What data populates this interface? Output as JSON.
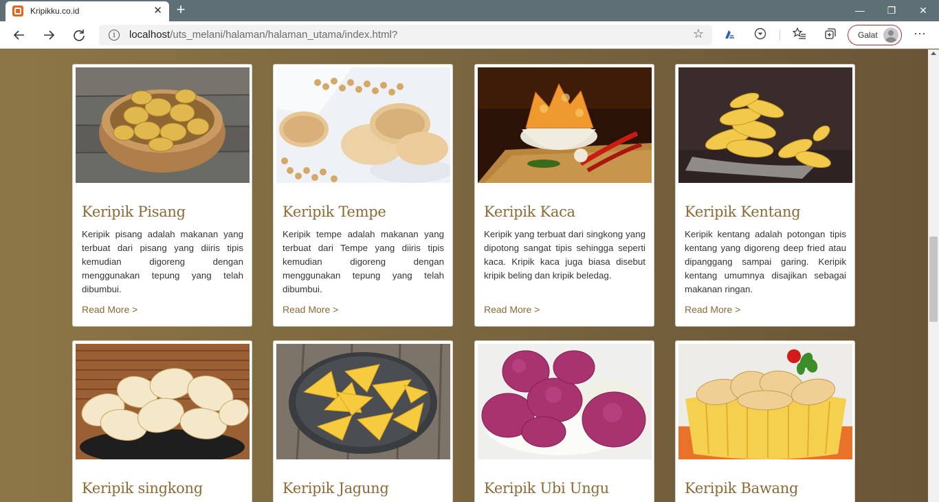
{
  "browser": {
    "tab_title": "Kripikku.co.id",
    "tab_close": "✕",
    "new_tab": "+",
    "url_host": "localhost",
    "url_path": "/uts_melani/halaman/halaman_utama/index.html?",
    "profile_label": "Galat",
    "window_controls": {
      "minimize": "—",
      "restore": "❐",
      "close": "✕"
    },
    "icons": [
      "back-arrow-icon",
      "forward-arrow-icon",
      "refresh-icon",
      "info-icon",
      "favorite-star-icon",
      "read-aloud-icon",
      "download-icon",
      "favorites-list-icon",
      "collections-icon",
      "profile-avatar-icon",
      "more-menu-icon"
    ]
  },
  "products": [
    {
      "title": "Keripik Pisang",
      "description": "Keripik pisang adalah makanan yang terbuat dari pisang yang diiris tipis kemudian digoreng dengan menggunakan tepung yang telah dibumbui.",
      "link": "Read More >"
    },
    {
      "title": "Keripik Tempe",
      "description": "Keripik tempe adalah makanan yang terbuat dari Tempe yang diiris tipis kemudian digoreng dengan menggunakan tepung yang telah dibumbui.",
      "link": "Read More >"
    },
    {
      "title": "Keripik Kaca",
      "description": "Keripik yang terbuat dari singkong yang dipotong sangat tipis sehingga seperti kaca. Kripik kaca juga biasa disebut kripik beling dan kripik beledag.",
      "link": "Read More >"
    },
    {
      "title": "Keripik Kentang",
      "description": "Keripik kentang adalah potongan tipis kentang yang digoreng deep fried atau dipanggang sampai garing. Keripik kentang umumnya disajikan sebagai makanan ringan.",
      "link": "Read More >"
    },
    {
      "title": "Keripik singkong"
    },
    {
      "title": "Keripik Jagung"
    },
    {
      "title": "Keripik Ubi Ungu"
    },
    {
      "title": "Keripik Bawang"
    }
  ],
  "colors": {
    "page_bg": "#7f6a42",
    "accent": "#8b6a35",
    "card_bg": "#ffffff"
  }
}
